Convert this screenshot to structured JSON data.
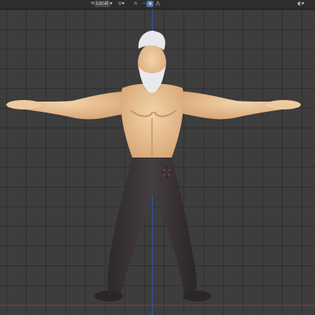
{
  "header": {
    "orientation_label": "Local",
    "orientation_icon": "transform-orientation-icon",
    "pivot_icon": "pivot-point-icon",
    "snap_icon": "magnet-snap-icon",
    "proportional_icon": "proportional-edit-icon",
    "overlay_icon": "overlay-toggle-icon"
  },
  "viewport": {
    "grid_color": "#3d3d3d",
    "x_axis_color": "#9b3040",
    "z_axis_color": "#2d5aa8"
  },
  "character": {
    "skin_color": "#e8c49a",
    "pants_color": "#3a3438",
    "hair_color": "#e8e8ec"
  }
}
